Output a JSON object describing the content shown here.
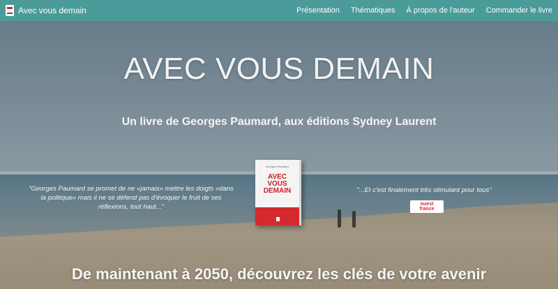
{
  "navbar": {
    "brand": "Avec vous demain",
    "links": [
      "Présentation",
      "Thématiques",
      "À propos de l'auteur",
      "Commander le livre"
    ]
  },
  "hero": {
    "title": "AVEC VOUS DEMAIN",
    "subtitle": "Un livre de Georges Paumard, aux éditions Sydney Laurent",
    "quote_left": "\"Georges Paumard se promet de ne «jamais» mettre les doigts «dans la politique» mais il ne se défend pas d'évoquer le fruit de ses réflexions, tout haut...\"",
    "quote_right": "\"...Et c'est finalement très stimulant pour tous\"",
    "tagline": "De maintenant à 2050, découvrez les clés de votre avenir"
  },
  "book": {
    "author": "Georges Paumard",
    "title_line1": "AVEC VOUS",
    "title_line2": "DEMAIN"
  },
  "press": {
    "name_line1": "ouest",
    "name_line2": "france"
  },
  "colors": {
    "navbar": "#4a9b99",
    "accent_red": "#d32a2f"
  }
}
